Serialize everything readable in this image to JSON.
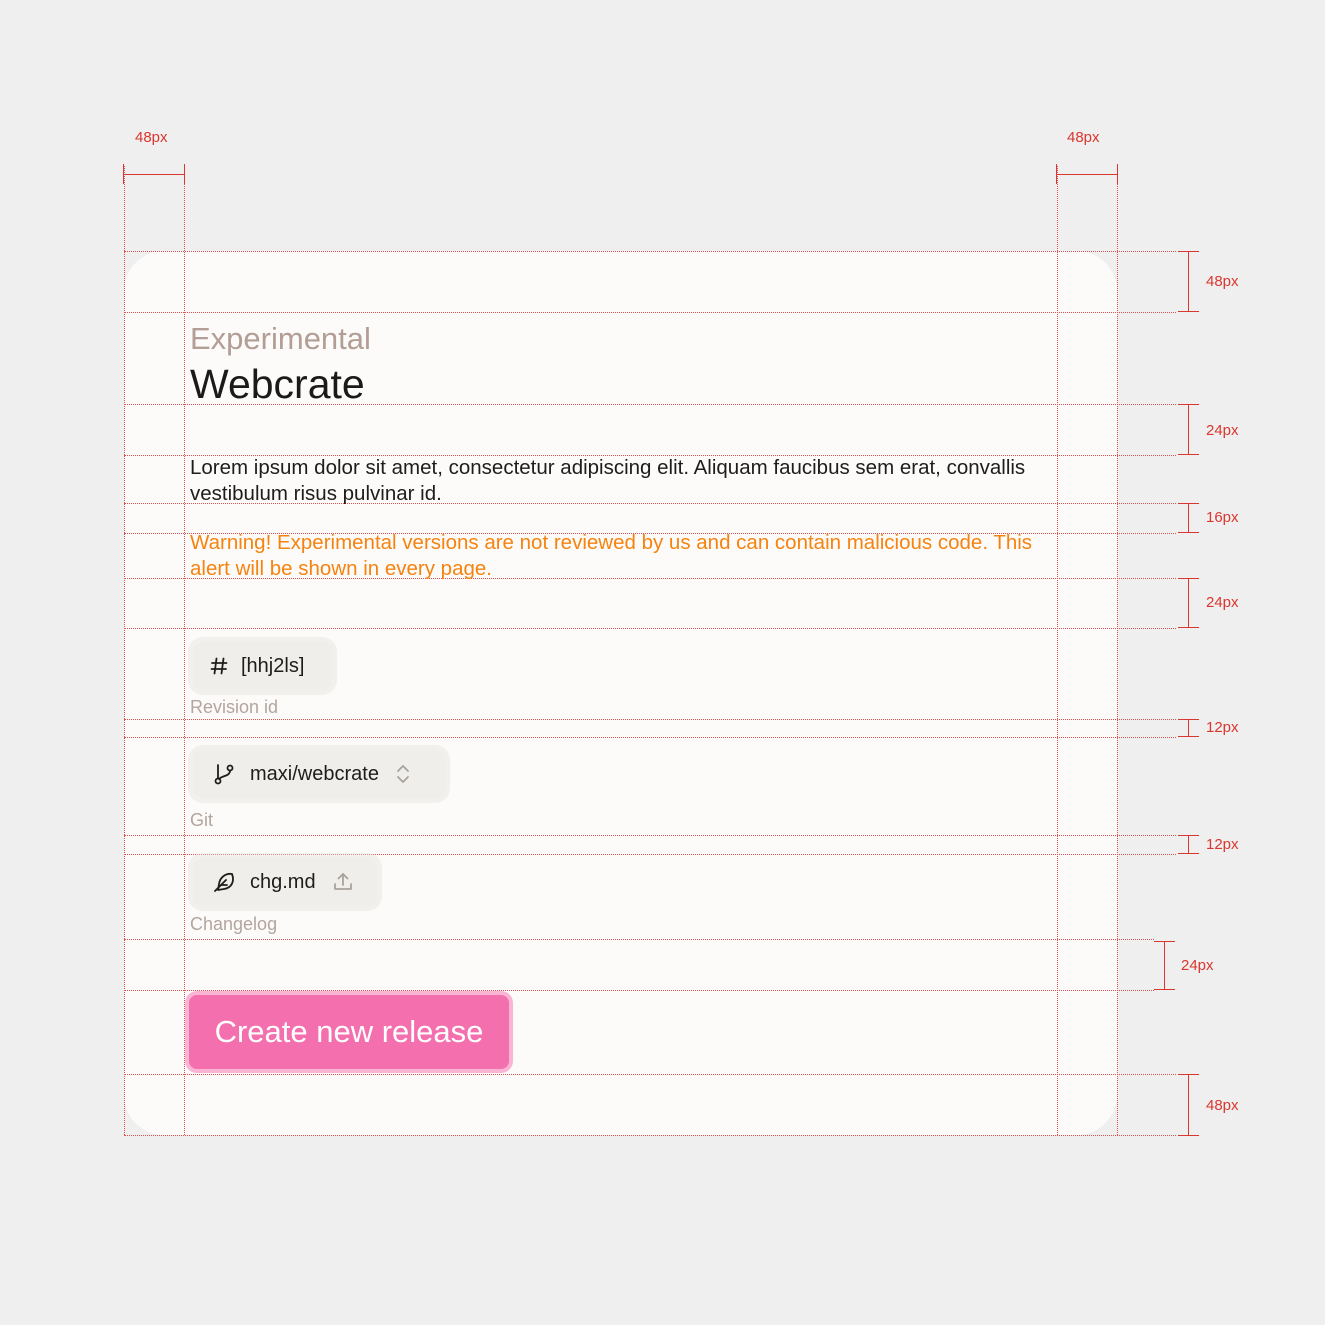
{
  "spec": {
    "left_margin": "48px",
    "right_margin": "48px",
    "top_padding": "48px",
    "title_gap": "24px",
    "paragraph_gap": "16px",
    "alert_gap": "24px",
    "field_gap_1": "12px",
    "field_gap_2": "12px",
    "button_gap": "24px",
    "bottom_padding": "48px"
  },
  "header": {
    "eyebrow": "Experimental",
    "title": "Webcrate"
  },
  "description": "Lorem ipsum dolor sit amet, consectetur adipiscing elit. Aliquam faucibus sem erat, convallis vestibulum risus pulvinar id.",
  "warning": "Warning! Experimental versions are not reviewed by us and can contain malicious code. This alert will be shown in every page.",
  "fields": {
    "revision": {
      "icon": "hash-icon",
      "value": "[hhj2ls]",
      "label": "Revision id"
    },
    "git": {
      "icon": "git-branch-icon",
      "value": "maxi/webcrate",
      "trailing_icon": "chevron-up-down-icon",
      "label": "Git"
    },
    "changelog": {
      "icon": "feather-icon",
      "value": "chg.md",
      "trailing_icon": "upload-icon",
      "label": "Changelog"
    }
  },
  "cta": {
    "label": "Create new release"
  },
  "colors": {
    "accent": "#f36fae",
    "warning": "#f6830f",
    "guide": "#d9372f"
  }
}
